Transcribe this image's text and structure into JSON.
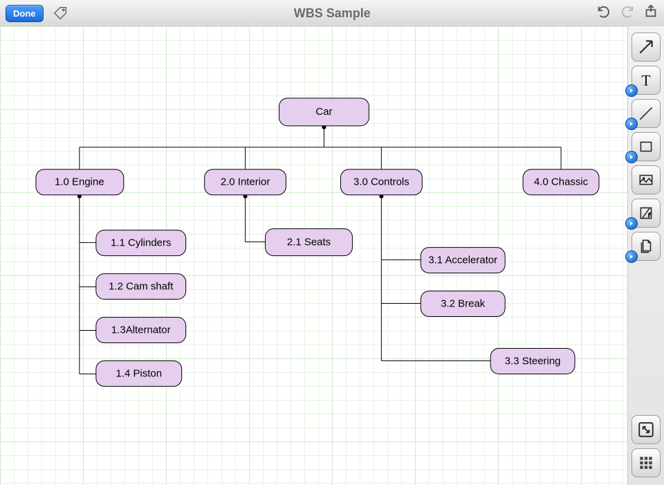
{
  "header": {
    "done_label": "Done",
    "title": "WBS Sample"
  },
  "nodes": {
    "root": "Car",
    "level1": [
      {
        "id": "1.0",
        "label": "1.0 Engine"
      },
      {
        "id": "2.0",
        "label": "2.0 Interior"
      },
      {
        "id": "3.0",
        "label": "3.0 Controls"
      },
      {
        "id": "4.0",
        "label": "4.0 Chassic"
      }
    ],
    "engine_children": [
      {
        "label": "1.1 Cylinders"
      },
      {
        "label": "1.2 Cam shaft"
      },
      {
        "label": "1.3Alternator"
      },
      {
        "label": "1.4 Piston"
      }
    ],
    "interior_children": [
      {
        "label": "2.1 Seats"
      }
    ],
    "controls_children": [
      {
        "label": "3.1 Accelerator"
      },
      {
        "label": "3.2 Break"
      },
      {
        "label": "3.3 Steering"
      }
    ]
  },
  "palette": {
    "node_fill": "#e6ceee",
    "node_stroke": "#000000"
  },
  "tools": [
    {
      "name": "select-arrow",
      "has_badge": false
    },
    {
      "name": "text-tool",
      "has_badge": true
    },
    {
      "name": "line-tool",
      "has_badge": true
    },
    {
      "name": "shape-tool",
      "has_badge": true
    },
    {
      "name": "image-tool",
      "has_badge": false
    },
    {
      "name": "function-tool",
      "has_badge": true
    },
    {
      "name": "layers-tool",
      "has_badge": true
    }
  ]
}
